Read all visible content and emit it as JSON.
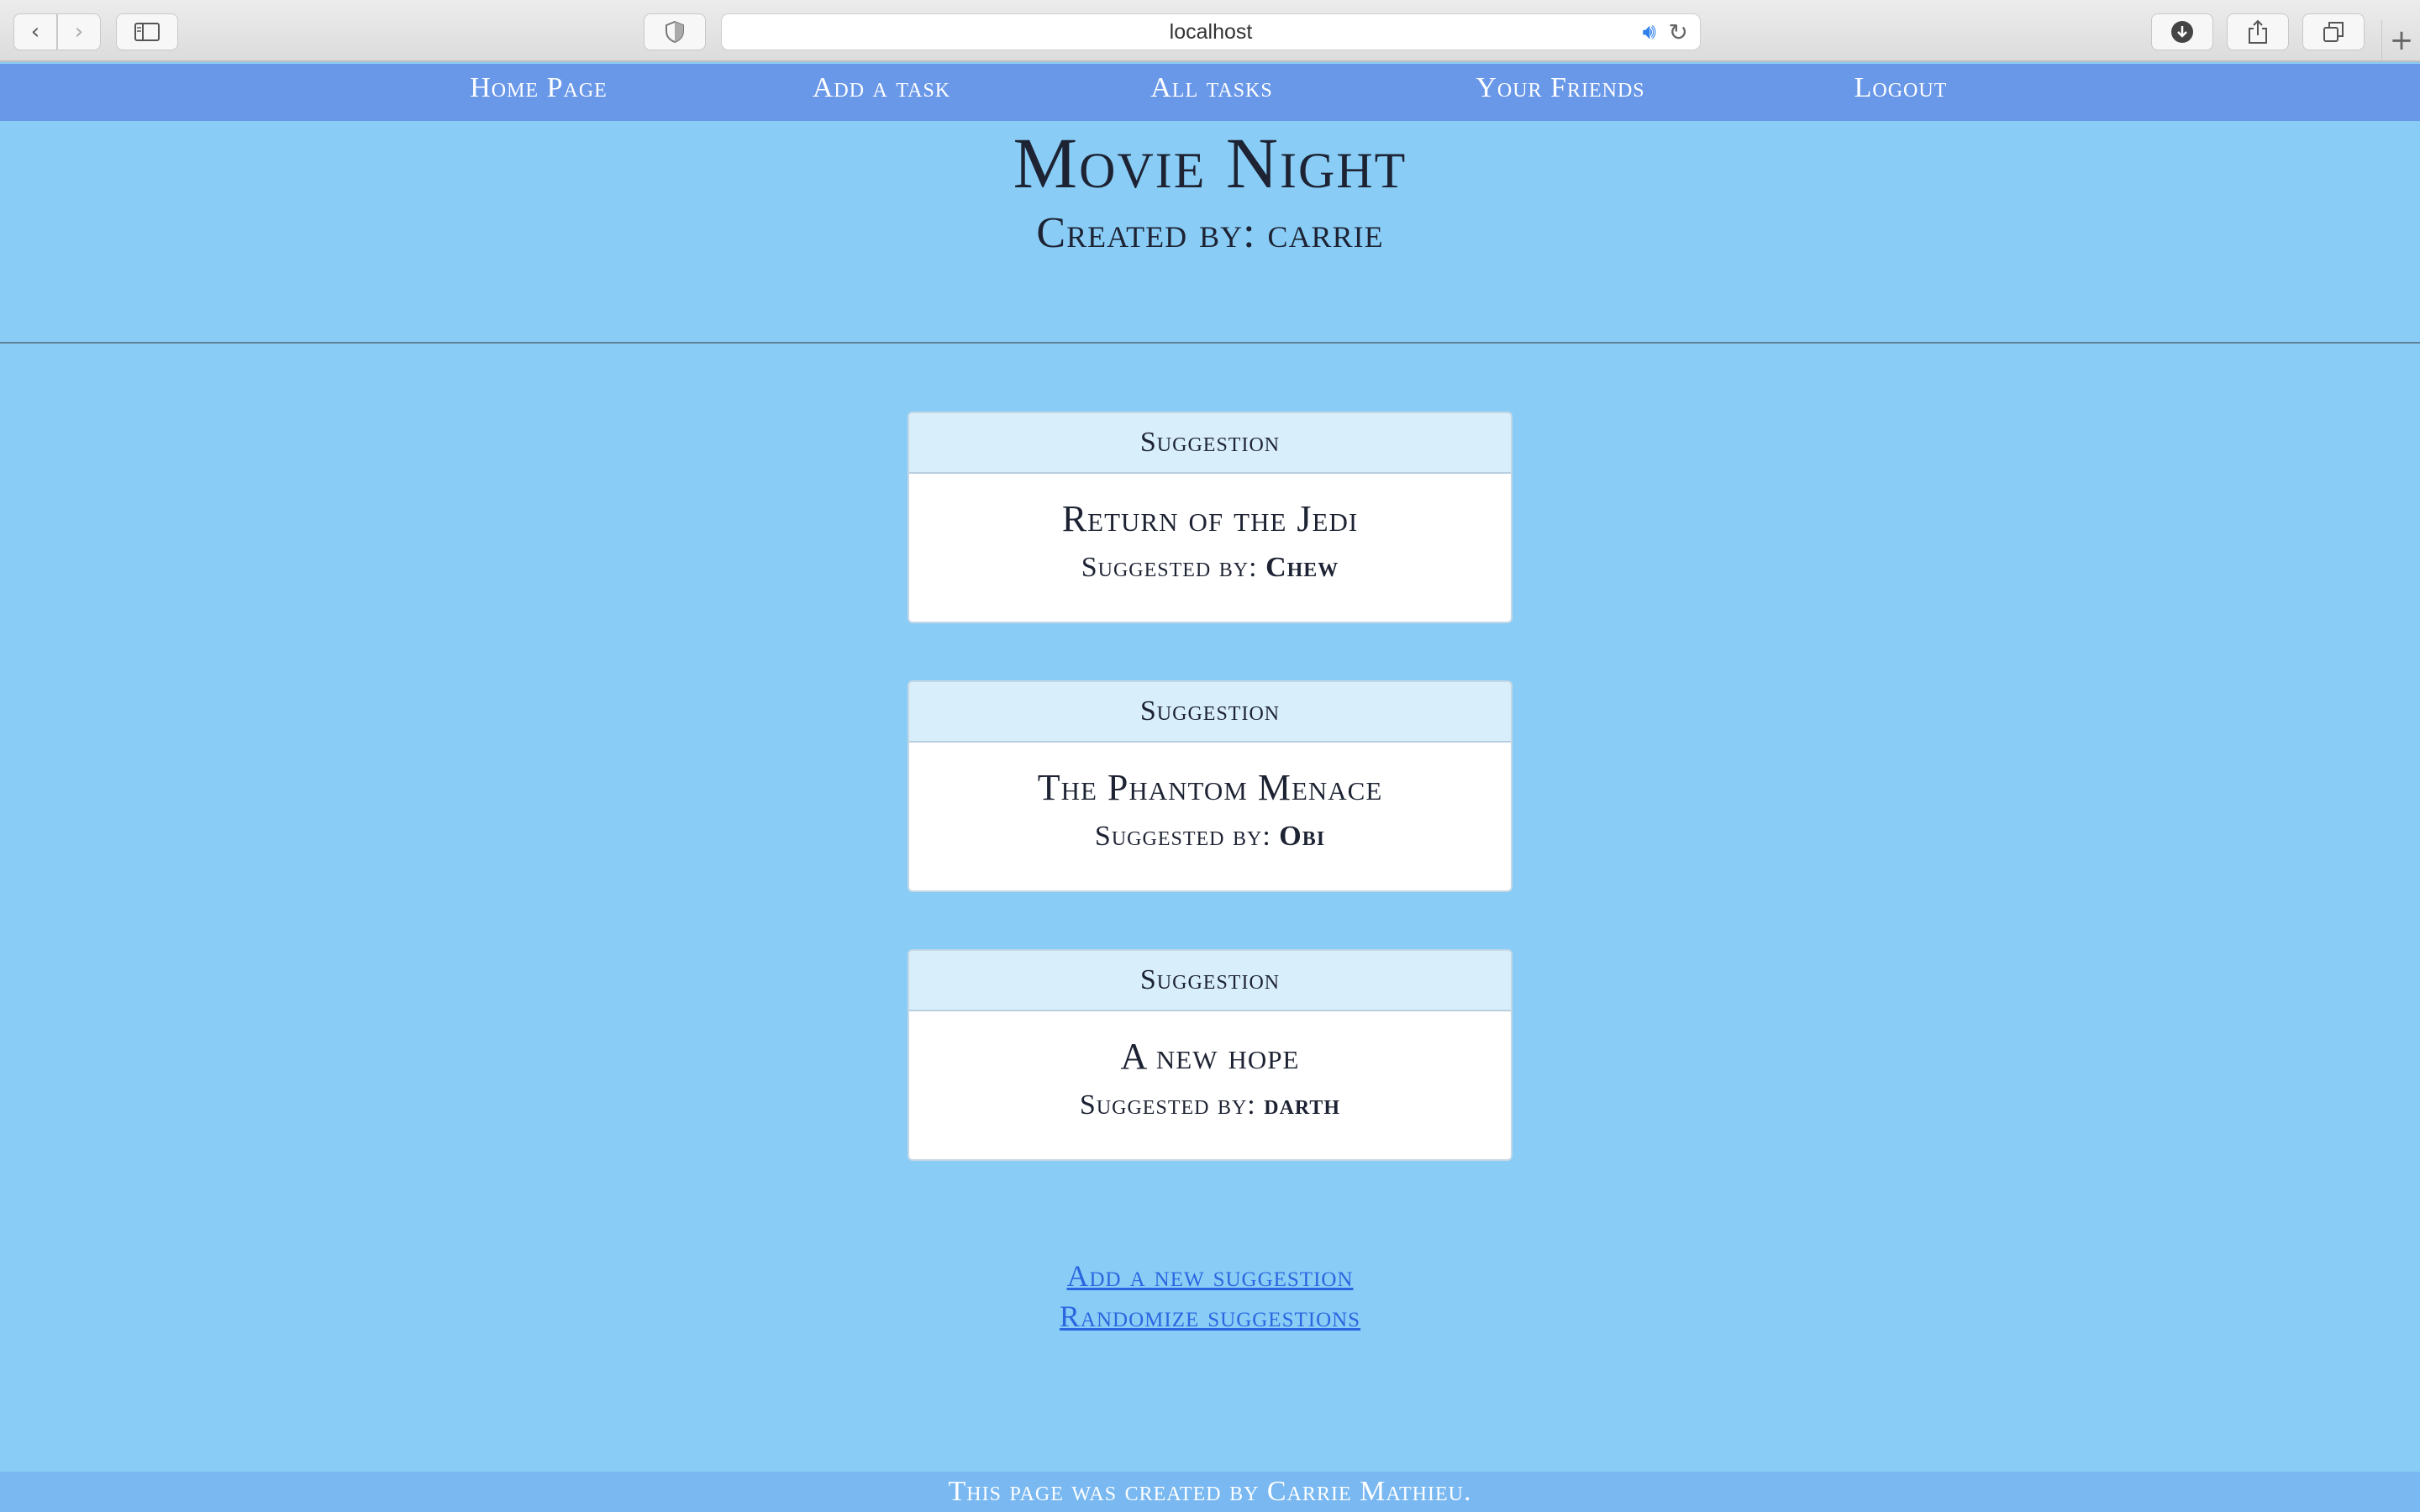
{
  "browser": {
    "url": "localhost",
    "icons": {
      "back": "chevron-left-icon",
      "forward": "chevron-right-icon",
      "sidebar": "sidebar-icon",
      "privacy": "shield-icon",
      "audio": "speaker-icon",
      "reload": "reload-icon",
      "download": "download-icon",
      "share": "share-icon",
      "tabs": "tabs-icon",
      "new_tab": "plus-icon"
    }
  },
  "nav": {
    "items": [
      {
        "label": "Home Page"
      },
      {
        "label": "Add a task"
      },
      {
        "label": "All tasks"
      },
      {
        "label": "Your Friends"
      },
      {
        "label": "Logout"
      }
    ]
  },
  "header": {
    "title": "Movie Night",
    "subtitle": "Created by: carrie"
  },
  "suggestions": [
    {
      "header": "Suggestion",
      "title": "Return of the Jedi",
      "by_label": "Suggested by:",
      "by_name": "Chew"
    },
    {
      "header": "Suggestion",
      "title": "The Phantom Menace",
      "by_label": "Suggested by:",
      "by_name": "Obi"
    },
    {
      "header": "Suggestion",
      "title": "A new hope",
      "by_label": "Suggested by:",
      "by_name": "darth"
    }
  ],
  "actions": {
    "add_label": "Add a new suggestion",
    "randomize_label": "Randomize suggestions"
  },
  "footer": {
    "text": "This page was created by Carrie Mathieu."
  },
  "colors": {
    "page_bg": "#89cdf7",
    "nav_bg": "#6a98e8",
    "footer_bg": "#79b8f1",
    "card_header_bg": "#d8eefb",
    "link": "#2a66e0",
    "text": "#1d2333"
  }
}
